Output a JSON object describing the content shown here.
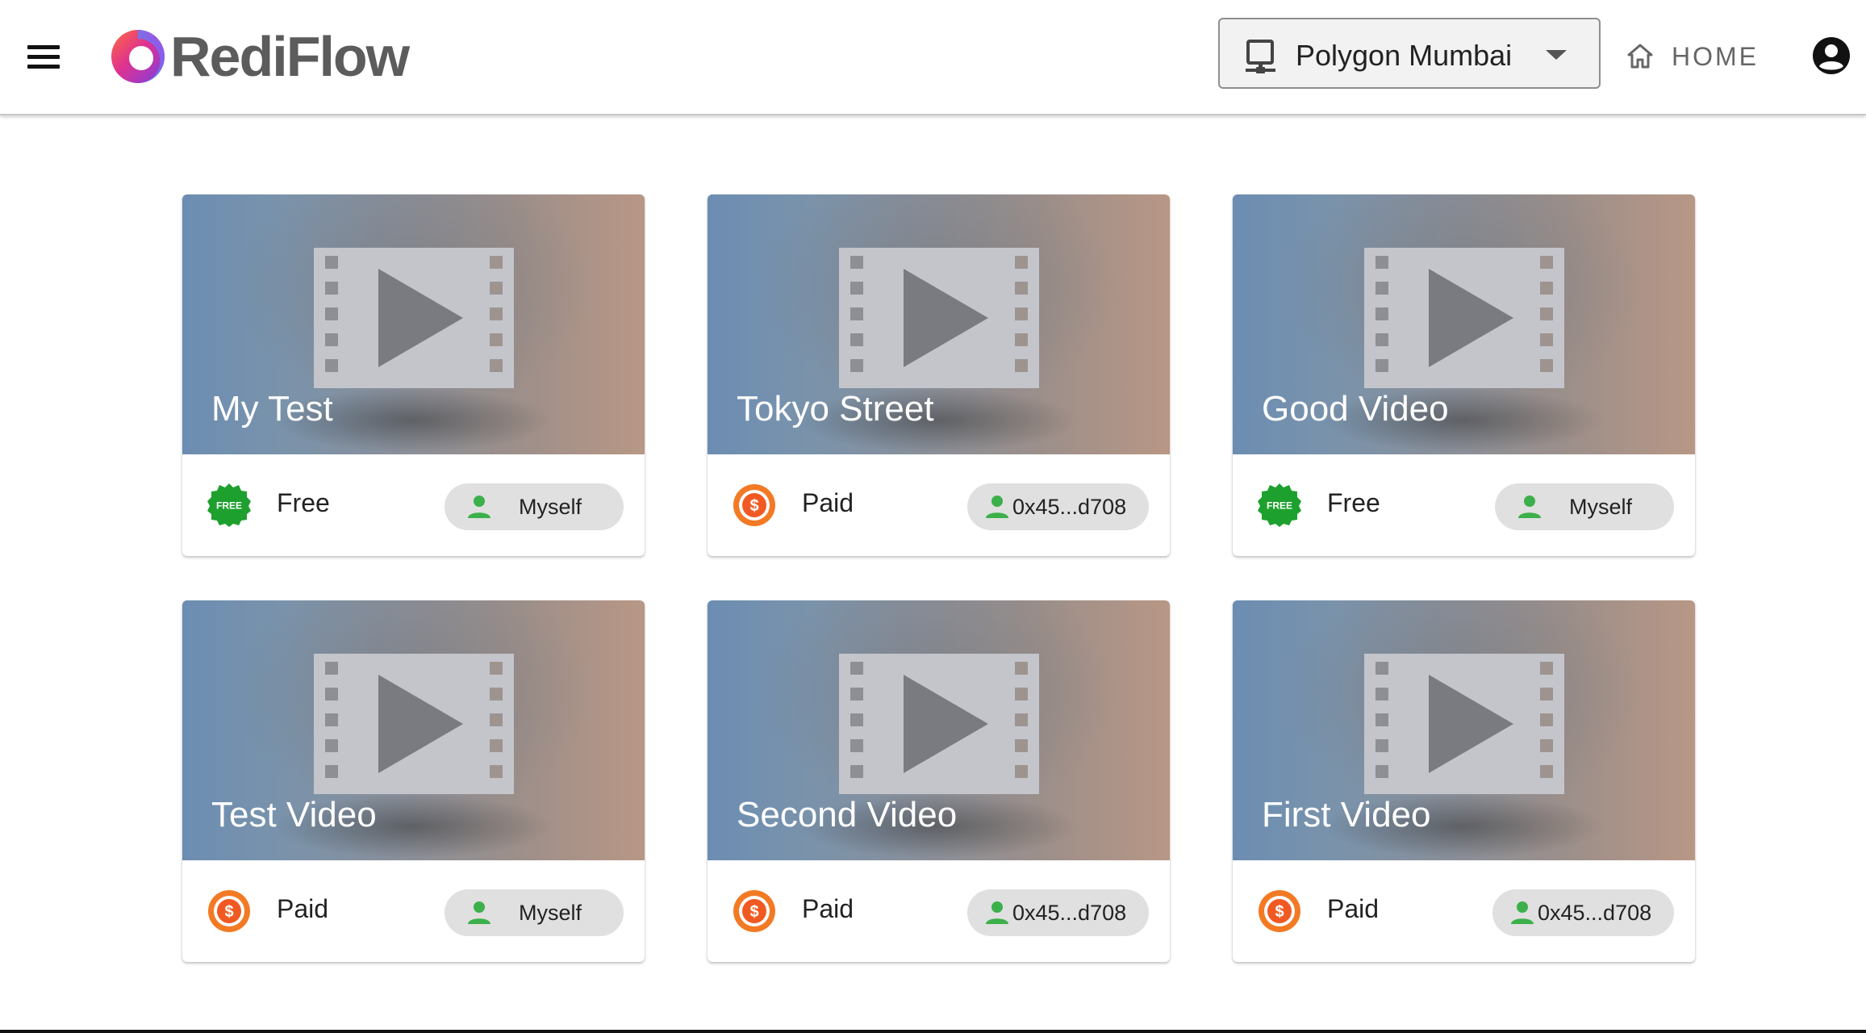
{
  "app": {
    "brand": "RediFlow",
    "network": {
      "selected": "Polygon Mumbai"
    },
    "nav": {
      "home_label": "HOME"
    }
  },
  "videos": [
    {
      "title": "My Test",
      "price_label": "Free",
      "price_badge": "FREE",
      "price_icon": "free-badge-icon",
      "owner": "Myself"
    },
    {
      "title": "Tokyo Street",
      "price_label": "Paid",
      "price_badge": "$",
      "price_icon": "dollar-coin-icon",
      "owner": "0x45...d708"
    },
    {
      "title": "Good Video",
      "price_label": "Free",
      "price_badge": "FREE",
      "price_icon": "free-badge-icon",
      "owner": "Myself"
    },
    {
      "title": "Test Video",
      "price_label": "Paid",
      "price_badge": "$",
      "price_icon": "dollar-coin-icon",
      "owner": "Myself"
    },
    {
      "title": "Second Video",
      "price_label": "Paid",
      "price_badge": "$",
      "price_icon": "dollar-coin-icon",
      "owner": "0x45...d708"
    },
    {
      "title": "First Video",
      "price_label": "Paid",
      "price_badge": "$",
      "price_icon": "dollar-coin-icon",
      "owner": "0x45...d708"
    }
  ],
  "colors": {
    "free_badge": "#1ea02e",
    "paid_coin": "#f05a22",
    "owner_icon": "#3cb04a",
    "chip_bg": "#e0e0e0",
    "brand_text": "#5c5c5c"
  },
  "icons": {
    "menu": "hamburger-menu-icon",
    "network": "computer-network-icon",
    "home": "home-icon",
    "account": "account-circle-icon",
    "thumbnail": "video-film-play-icon",
    "owner": "person-icon"
  }
}
